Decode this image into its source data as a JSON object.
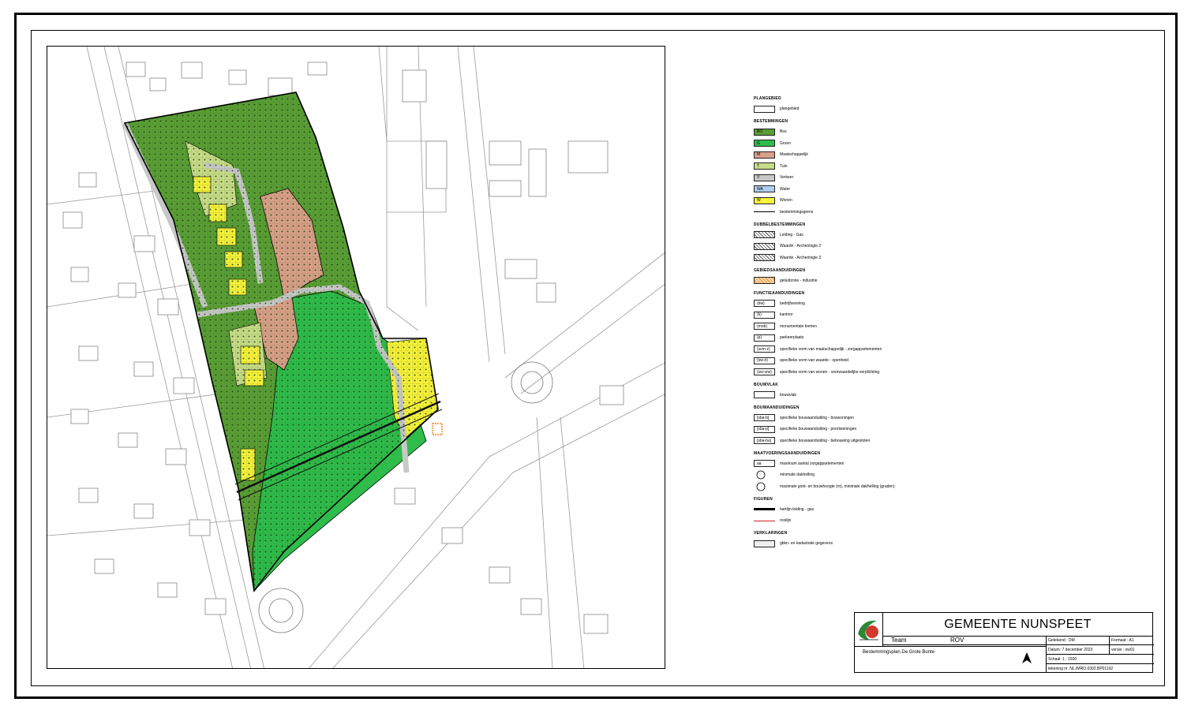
{
  "legend": {
    "sections": [
      {
        "heading": "PLANGEBIED",
        "items": [
          {
            "kind": "plangebied",
            "code": "",
            "label": "plangebied"
          }
        ]
      },
      {
        "heading": "BESTEMMINGEN",
        "items": [
          {
            "kind": "fill",
            "code": "BO",
            "label": "Bos",
            "color": "#5a9e35"
          },
          {
            "kind": "fill",
            "code": "G",
            "label": "Groen",
            "color": "#2ebc4a"
          },
          {
            "kind": "fill",
            "code": "M",
            "label": "Maatschappelijk",
            "color": "#d9a088"
          },
          {
            "kind": "fill",
            "code": "T",
            "label": "Tuin",
            "color": "#c8dc88"
          },
          {
            "kind": "fill",
            "code": "V",
            "label": "Verkeer",
            "color": "#c8c8c8"
          },
          {
            "kind": "fill",
            "code": "WA",
            "label": "Water",
            "color": "#aecfef"
          },
          {
            "kind": "fill",
            "code": "W",
            "label": "Wonen",
            "color": "#f7f23a"
          },
          {
            "kind": "line",
            "code": "",
            "label": "bestemmingsgrens"
          }
        ]
      },
      {
        "heading": "DUBBELBESTEMMINGEN",
        "items": [
          {
            "kind": "hatch",
            "code": "",
            "label": "Leiding - Gas"
          },
          {
            "kind": "hatch",
            "code": "",
            "label": "Waarde - Archeologie 2"
          },
          {
            "kind": "hatch",
            "code": "",
            "label": "Waarde - Archeologie 3"
          }
        ]
      },
      {
        "heading": "GEBIEDSAANDUIDINGEN",
        "items": [
          {
            "kind": "orange",
            "code": "",
            "label": "geluidzone - industrie"
          }
        ]
      },
      {
        "heading": "FUNCTIEAANDUIDINGEN",
        "items": [
          {
            "kind": "outline",
            "code": "(bw)",
            "label": "bedrijfswoning"
          },
          {
            "kind": "outline",
            "code": "(k)",
            "label": "kantoor"
          },
          {
            "kind": "outline",
            "code": "(mob)",
            "label": "monumentale bomen"
          },
          {
            "kind": "outline",
            "code": "(p)",
            "label": "parkeerplaats"
          },
          {
            "kind": "outline",
            "code": "(svm-z)",
            "label": "specifieke vorm van maatschappelijk - zorgappartementen"
          },
          {
            "kind": "outline",
            "code": "(sw-o)",
            "label": "specifieke vorm van waarde - openheid"
          },
          {
            "kind": "outline",
            "code": "(sw-vrw)",
            "label": "specifieke vorm van wonen - voorwaardelijke verplichting"
          }
        ]
      },
      {
        "heading": "BOUWVLAK",
        "items": [
          {
            "kind": "outline",
            "code": "",
            "label": "bouwvlak"
          }
        ]
      },
      {
        "heading": "BOUWAANDUIDINGEN",
        "items": [
          {
            "kind": "outline",
            "code": "[sba-b]",
            "label": "specifieke bouwaanduiding - boswoningen"
          },
          {
            "kind": "outline",
            "code": "[sba-p]",
            "label": "specifieke bouwaanduiding - poortwoningen"
          },
          {
            "kind": "outline",
            "code": "[sba-bu]",
            "label": "specifieke bouwaanduiding - bebouwing uitgesloten"
          }
        ]
      },
      {
        "heading": "MAATVOERINGSAANDUIDINGEN",
        "items": [
          {
            "kind": "outline",
            "code": "aa",
            "label": "maximum aantal zorgappartementen"
          },
          {
            "kind": "circle",
            "code": "",
            "label": "minimale dakhelling"
          },
          {
            "kind": "circle",
            "code": "",
            "label": "maximale goot- en bouwhoogte (m), minimale dakhelling (graden)"
          }
        ]
      },
      {
        "heading": "FIGUREN",
        "items": [
          {
            "kind": "pipe",
            "code": "",
            "label": "hartlijn leiding - gas"
          },
          {
            "kind": "redline",
            "code": "",
            "label": "rooilijn"
          }
        ]
      },
      {
        "heading": "VERKLARINGEN",
        "items": [
          {
            "kind": "grey",
            "code": "",
            "label": "gbkn- en kadastrale gegevens"
          }
        ]
      }
    ]
  },
  "title_block": {
    "municipality": "GEMEENTE NUNSPEET",
    "team_label": "Team",
    "team_value": "ROV",
    "plan_name": "Bestemmingsplan De Grote Bunte",
    "getekend": "Getekend : DM",
    "formaat": "Formaat : A1",
    "datum": "Datum: 7 december 2023",
    "versie": "versie : ow01",
    "schaal": "Schaal: 1 : 1500",
    "tekening": "tekening nr. NL.IMRO.0302.BP01192"
  }
}
